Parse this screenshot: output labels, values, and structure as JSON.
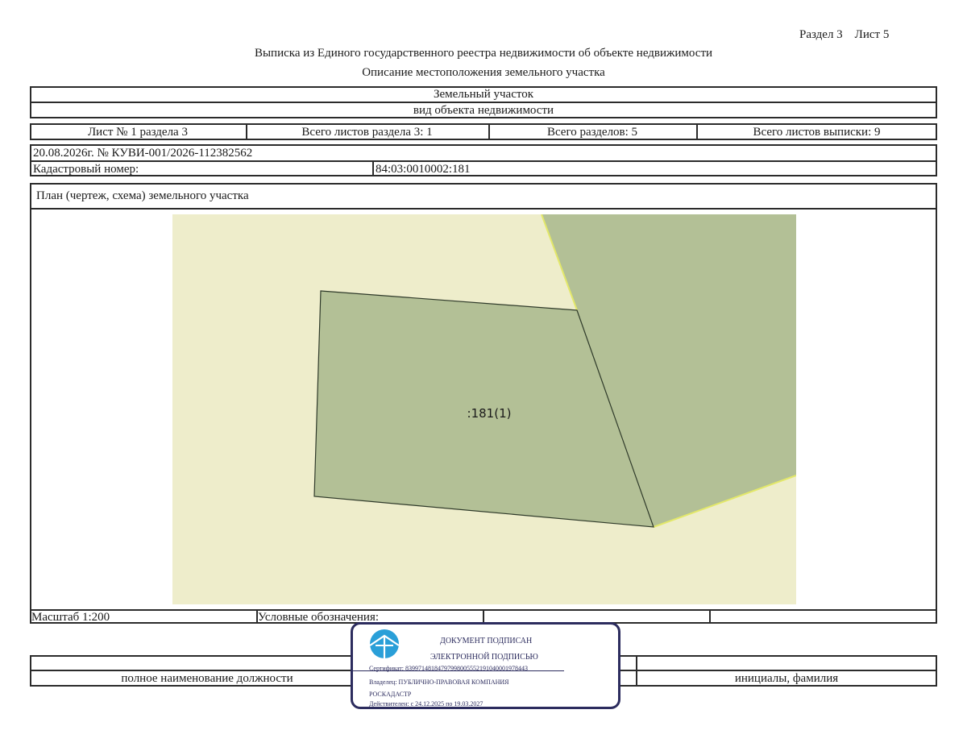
{
  "header": {
    "section_sheet": "Раздел 3    Лист 5",
    "title": "Выписка из Единого государственного реестра недвижимости об объекте недвижимости",
    "subtitle": "Описание местоположения земельного участка"
  },
  "object": {
    "type": "Земельный участок",
    "type_caption": "вид объекта недвижимости"
  },
  "sheets": {
    "sheet_no": "Лист № 1 раздела 3",
    "total_sheets_section": "Всего листов раздела 3: 1",
    "total_sections": "Всего разделов: 5",
    "total_sheets_extract": "Всего листов выписки: 9"
  },
  "record": {
    "date_number": "20.08.2026г. № КУВИ-001/2026-112382562",
    "cadastral_label": "Кадастровый номер:",
    "cadastral_value": "84:03:0010002:181"
  },
  "plan": {
    "title": "План (чертеж, схема) земельного участка",
    "parcel_label": ":181(1)",
    "colors": {
      "background": "#EEEDCB",
      "parcel_fill": "#B3C096",
      "outline": "#2F3A2A",
      "neighbor_edge": "#E3E86A"
    }
  },
  "legend": {
    "scale": "Масштаб 1:200",
    "legend_label": "Условные обозначения:"
  },
  "signature": {
    "position_caption": "полное наименование должности",
    "name_caption": "инициалы, фамилия"
  },
  "stamp": {
    "line1": "ДОКУМЕНТ ПОДПИСАН",
    "line2": "ЭЛЕКТРОННОЙ ПОДПИСЬЮ",
    "certificate": "Сертификат: 8399714818479799800555219104000197844З",
    "owner": "Владелец: ПУБЛИЧНО-ПРАВОВАЯ КОМПАНИЯ",
    "owner2": "РОСКАДАСТР",
    "valid": "Действителен: с 24.12.2025 по 19.03.2027",
    "logo_color": "#2A9FD8",
    "frame_color": "#2C2C5E"
  }
}
